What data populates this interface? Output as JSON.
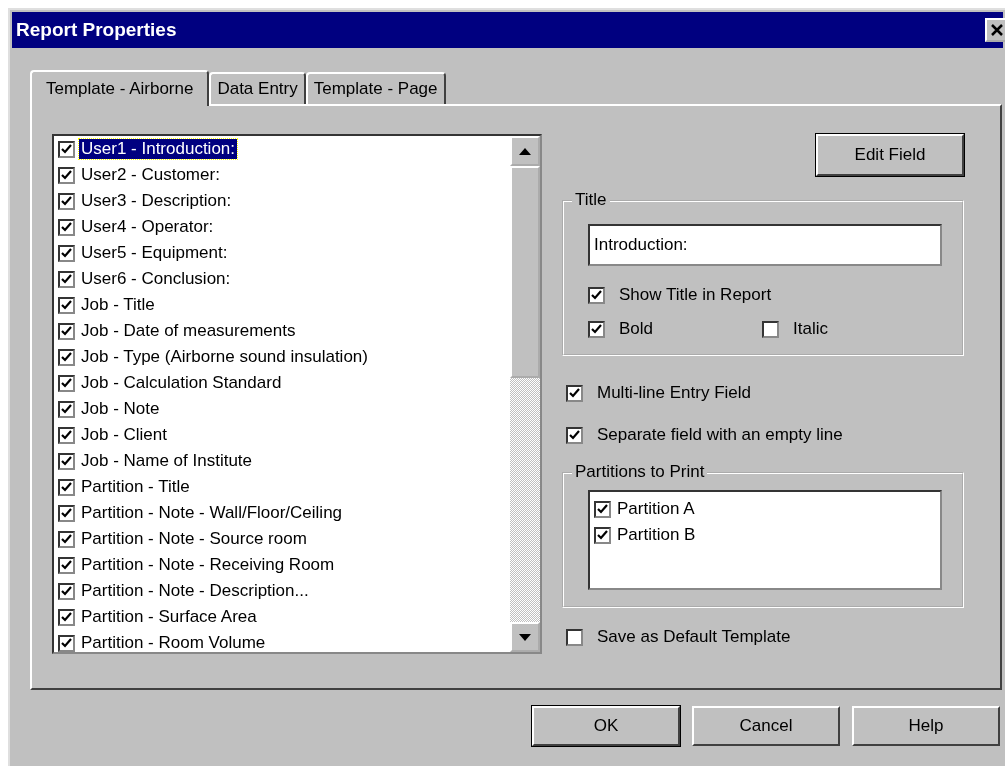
{
  "window": {
    "title": "Report Properties"
  },
  "tabs": [
    {
      "label": "Template - Airborne",
      "selected": true
    },
    {
      "label": "Data Entry",
      "selected": false
    },
    {
      "label": "Template - Page",
      "selected": false
    }
  ],
  "fields": [
    {
      "label": "User1 - Introduction:",
      "checked": true,
      "selected": true
    },
    {
      "label": "User2 - Customer:",
      "checked": true,
      "selected": false
    },
    {
      "label": "User3 - Description:",
      "checked": true,
      "selected": false
    },
    {
      "label": "User4 - Operator:",
      "checked": true,
      "selected": false
    },
    {
      "label": "User5 - Equipment:",
      "checked": true,
      "selected": false
    },
    {
      "label": "User6 - Conclusion:",
      "checked": true,
      "selected": false
    },
    {
      "label": "Job - Title",
      "checked": true,
      "selected": false
    },
    {
      "label": "Job - Date of measurements",
      "checked": true,
      "selected": false
    },
    {
      "label": "Job - Type (Airborne sound insulation)",
      "checked": true,
      "selected": false
    },
    {
      "label": "Job - Calculation Standard",
      "checked": true,
      "selected": false
    },
    {
      "label": "Job - Note",
      "checked": true,
      "selected": false
    },
    {
      "label": "Job - Client",
      "checked": true,
      "selected": false
    },
    {
      "label": "Job - Name of Institute",
      "checked": true,
      "selected": false
    },
    {
      "label": "Partition - Title",
      "checked": true,
      "selected": false
    },
    {
      "label": "Partition - Note - Wall/Floor/Ceiling",
      "checked": true,
      "selected": false
    },
    {
      "label": "Partition - Note - Source room",
      "checked": true,
      "selected": false
    },
    {
      "label": "Partition - Note - Receiving Room",
      "checked": true,
      "selected": false
    },
    {
      "label": "Partition - Note - Description...",
      "checked": true,
      "selected": false
    },
    {
      "label": "Partition - Surface Area",
      "checked": true,
      "selected": false
    },
    {
      "label": "Partition - Room Volume",
      "checked": true,
      "selected": false
    }
  ],
  "edit_field_button": "Edit Field",
  "title_group": {
    "label": "Title",
    "value": "Introduction:",
    "options": [
      {
        "label": "Show Title in Report",
        "checked": true
      },
      {
        "label": "Bold",
        "checked": true
      },
      {
        "label": "Italic",
        "checked": false
      }
    ]
  },
  "options": [
    {
      "label": "Multi-line Entry Field",
      "checked": true
    },
    {
      "label": "Separate field with an empty line",
      "checked": true
    }
  ],
  "partitions_group": {
    "label": "Partitions to Print",
    "items": [
      {
        "label": "Partition A",
        "checked": true
      },
      {
        "label": "Partition B",
        "checked": true
      }
    ]
  },
  "save_default": {
    "label": "Save as Default Template",
    "checked": false
  },
  "buttons": [
    {
      "label": "OK",
      "default": true
    },
    {
      "label": "Cancel",
      "default": false
    },
    {
      "label": "Help",
      "default": false
    }
  ]
}
